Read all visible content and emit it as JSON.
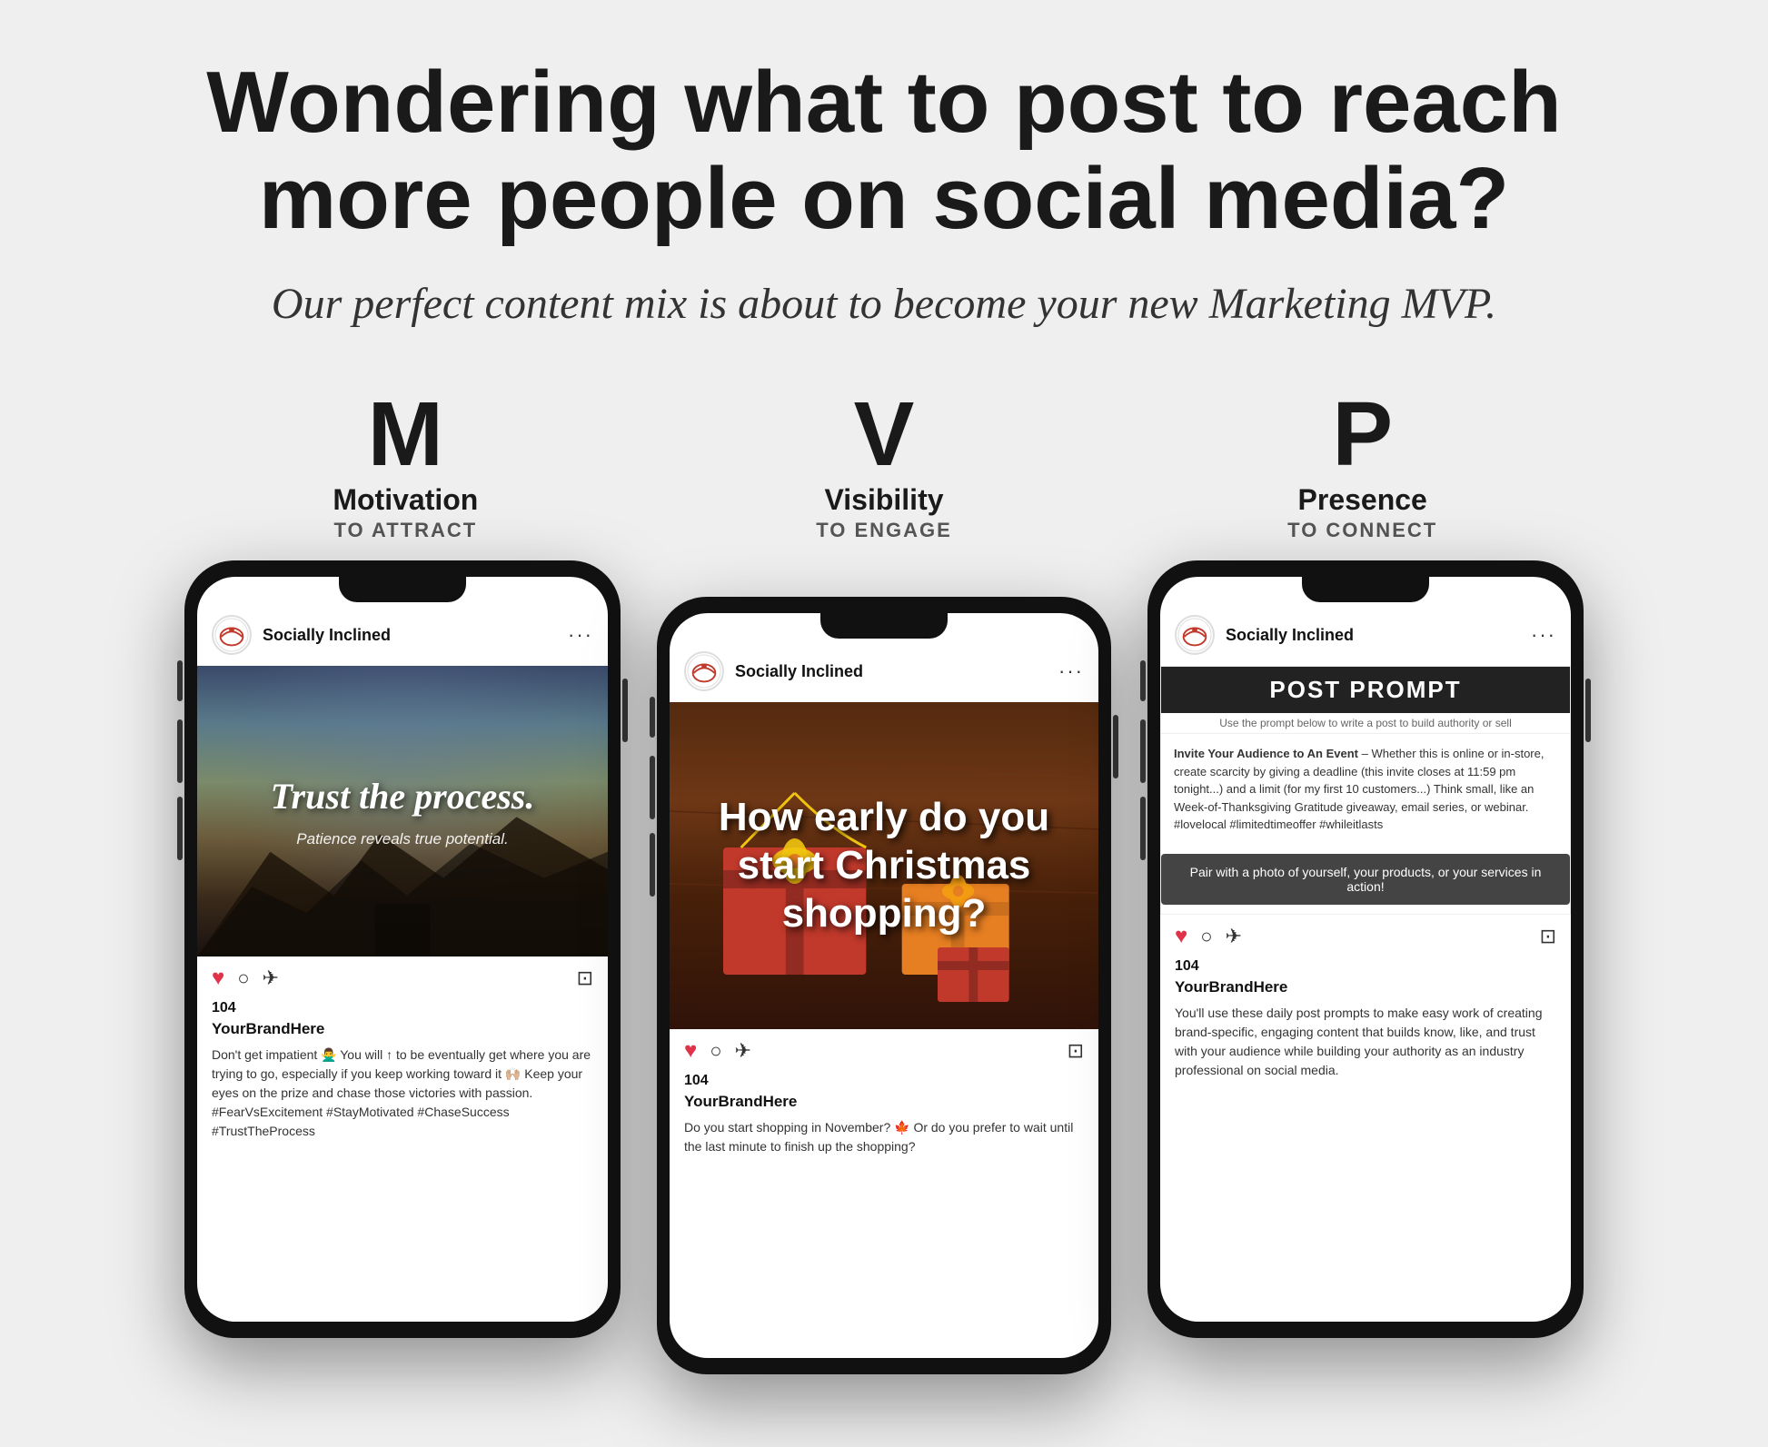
{
  "page": {
    "background_color": "#efefef",
    "headline": "Wondering what to post to reach more people on social media?",
    "subtitle": "Our perfect content mix is about to become your new Marketing MVP.",
    "mvp": {
      "m": {
        "letter": "M",
        "word": "Motivation",
        "sub": "TO ATTRACT"
      },
      "v": {
        "letter": "V",
        "word": "Visibility",
        "sub": "TO ENGAGE"
      },
      "p": {
        "letter": "P",
        "word": "Presence",
        "sub": "TO CONNECT"
      }
    },
    "phones": [
      {
        "id": "phone-left",
        "label": "motivation-phone",
        "header": {
          "username": "Socially Inclined",
          "dots": "···"
        },
        "post_image": {
          "type": "trust",
          "main_text": "Trust the process.",
          "sub_text": "Patience reveals true potential."
        },
        "likes": "104",
        "brand": "YourBrandHere",
        "caption": "Don't get impatient 🙅‍♂️ You will ↑ to be eventually get where you are trying to go, especially if you keep working toward it 🙌🏼 Keep your eyes on the prize and chase those victories with passion. #FearVsExcitement #StayMotivated #ChaseSuccess #TrustTheProcess"
      },
      {
        "id": "phone-center",
        "label": "visibility-phone",
        "header": {
          "username": "Socially Inclined",
          "dots": "···"
        },
        "post_image": {
          "type": "christmas",
          "headline": "How early do you start Christmas shopping?"
        },
        "likes": "104",
        "brand": "YourBrandHere",
        "caption": "Do you start shopping in November? 🍁 Or do you prefer to wait until the last minute to finish up the shopping?"
      },
      {
        "id": "phone-right",
        "label": "presence-phone",
        "header": {
          "username": "Socially Inclined",
          "dots": "···"
        },
        "post_image": {
          "type": "prompt",
          "header_text": "POST PROMPT",
          "sub_header": "Use the prompt below to write a post to build authority or sell",
          "prompt_title": "Invite Your Audience to An Event",
          "prompt_body": "– Whether this is online or in-store, create scarcity by giving a deadline (this invite closes at 11:59 pm tonight...) and a limit (for my first 10 customers...) Think small, like an Week-of-Thanksgiving Gratitude giveaway, email series, or webinar. #lovelocal #limitedtimeoffer #whileitlasts",
          "cta": "Pair with a photo of yourself, your products, or your services in action!"
        },
        "likes": "104",
        "brand": "YourBrandHere",
        "caption": "You'll use these daily post prompts to make easy work of creating brand-specific, engaging content that builds know, like, and trust with your audience while building your authority as an industry professional on social media."
      }
    ]
  }
}
